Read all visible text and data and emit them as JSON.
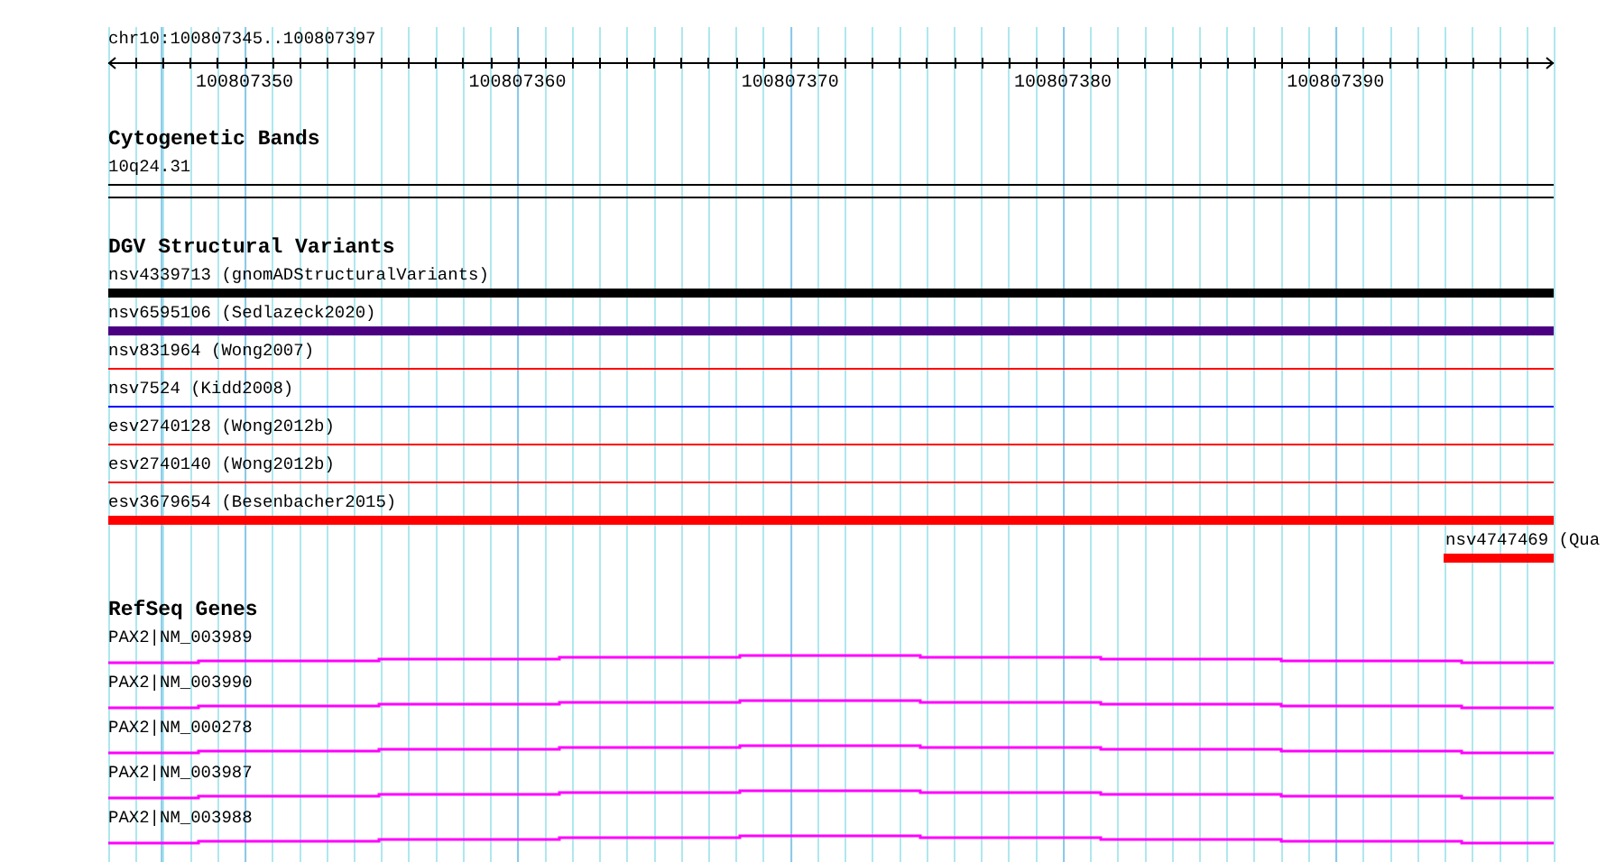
{
  "location": "chr10:100807345..100807397",
  "ruler": {
    "tick_labels": [
      "100807350",
      "100807360",
      "100807370",
      "100807380",
      "100807390"
    ]
  },
  "cytogenetic_bands": {
    "title": "Cytogenetic Bands",
    "band": "10q24.31"
  },
  "structural_variants": {
    "title": "DGV Structural Variants",
    "items": [
      {
        "label": "nsv4339713 (gnomADStructuralVariants)",
        "color": "#000000",
        "kind": "thick",
        "level": 1
      },
      {
        "label": "nsv6595106 (Sedlazeck2020)",
        "color": "#4b0082",
        "kind": "thick",
        "level": 1
      },
      {
        "label": "nsv831964 (Wong2007)",
        "color": "#ff0000",
        "kind": "thin",
        "level": 1
      },
      {
        "label": "nsv7524 (Kidd2008)",
        "color": "#0000ff",
        "kind": "thin",
        "level": 1
      },
      {
        "label": "esv2740128 (Wong2012b)",
        "color": "#ff0000",
        "kind": "thin",
        "level": 1
      },
      {
        "label": "esv2740140 (Wong2012b)",
        "color": "#ff0000",
        "kind": "thin",
        "level": 1
      },
      {
        "label": "esv3679654 (Besenbacher2015)",
        "color": "#ff0000",
        "kind": "thick",
        "level": 1
      },
      {
        "label": "nsv4747469 (Qua",
        "color": "#ff0000",
        "kind": "thick",
        "level": 0.076
      }
    ]
  },
  "refseq_genes": {
    "title": "RefSeq Genes",
    "items": [
      {
        "label": "PAX2|NM_003989"
      },
      {
        "label": "PAX2|NM_003990"
      },
      {
        "label": "PAX2|NM_000278"
      },
      {
        "label": "PAX2|NM_003987"
      },
      {
        "label": "PAX2|NM_003988"
      }
    ]
  }
}
